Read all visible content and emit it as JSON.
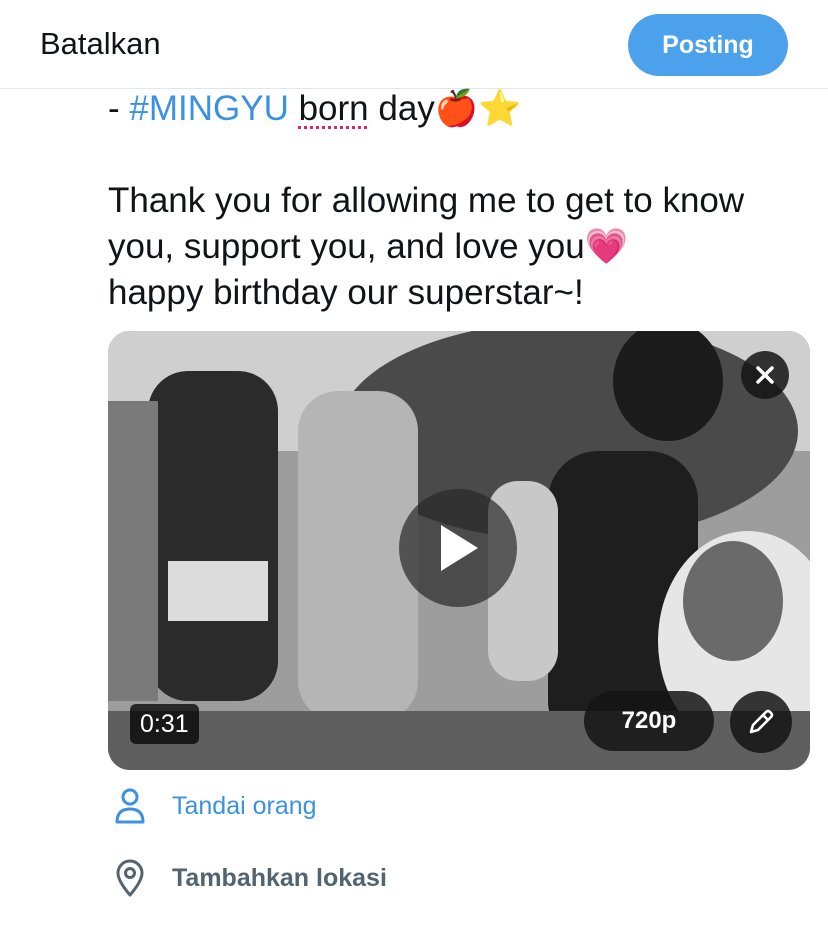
{
  "header": {
    "cancel_label": "Batalkan",
    "post_label": "Posting"
  },
  "compose": {
    "line1_prefix": "- ",
    "hashtag": "#MINGYU",
    "spell_word": "born",
    "line1_suffix": " day",
    "line1_emojis": [
      "🍎",
      "⭐"
    ],
    "line2": "Thank you for allowing me to get to know",
    "line3_text": "you, support you, and love you",
    "line3_emoji": "💗",
    "line4": "happy birthday our superstar~!"
  },
  "video": {
    "duration": "0:31",
    "quality": "720p",
    "close_icon": "close-icon",
    "play_icon": "play-icon",
    "edit_icon": "pencil-icon"
  },
  "options": {
    "tag_people_label": "Tandai orang",
    "add_location_label": "Tambahkan lokasi"
  },
  "colors": {
    "accent": "#4ca1ec",
    "hashtag": "#3b92e0",
    "secondary_text": "#536471"
  }
}
